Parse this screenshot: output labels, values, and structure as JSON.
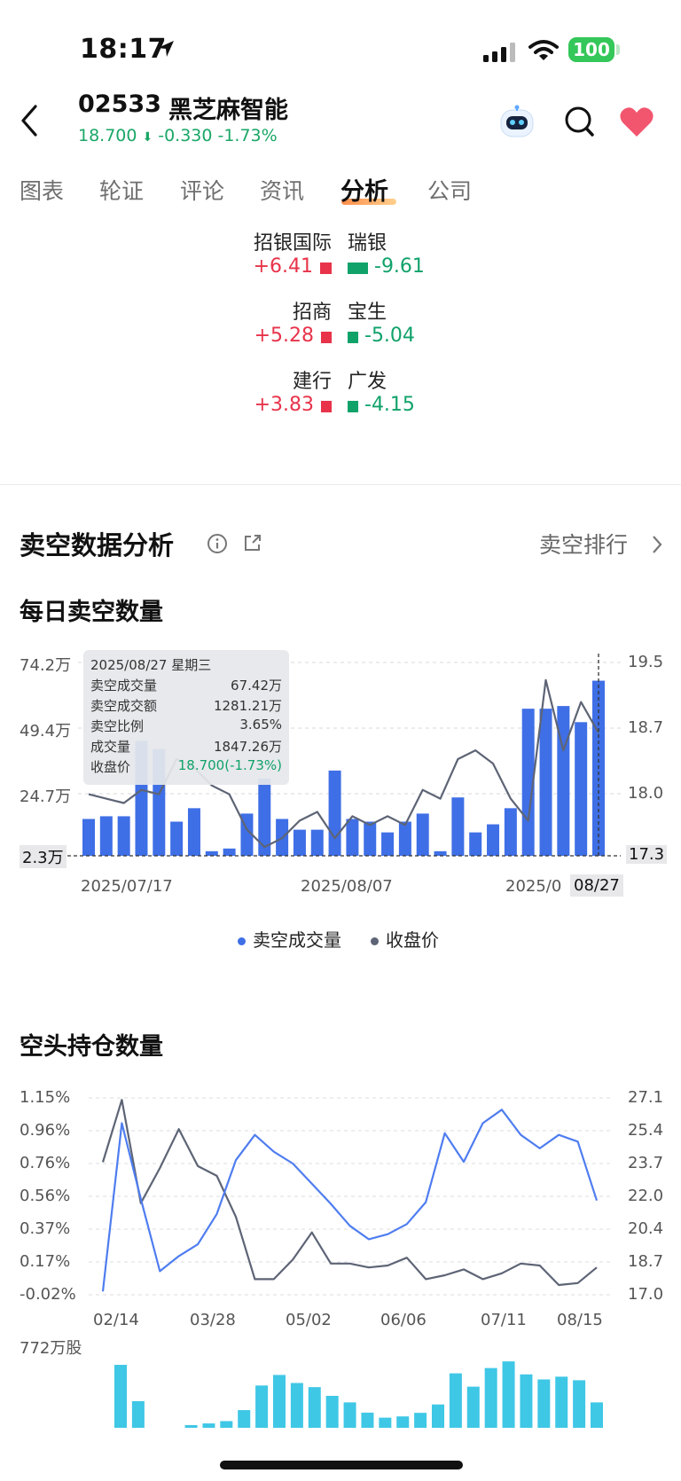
{
  "status_bar": {
    "time": "18:17",
    "battery": "100"
  },
  "header": {
    "code": "02533",
    "name": "黑芝麻智能",
    "price": "18.700",
    "change": "-0.330",
    "change_pct": "-1.73%"
  },
  "tabs": [
    "图表",
    "轮证",
    "评论",
    "资讯",
    "分析",
    "公司"
  ],
  "active_tab": "分析",
  "brokers": [
    {
      "buy_name": "招银国际",
      "buy_value": "+6.41",
      "buy_strength": 0.18,
      "sell_name": "瑞银",
      "sell_value": "-9.61",
      "sell_strength": 0.32
    },
    {
      "buy_name": "招商",
      "buy_value": "+5.28",
      "buy_strength": 0.16,
      "sell_name": "宝生",
      "sell_value": "-5.04",
      "sell_strength": 0.16
    },
    {
      "buy_name": "建行",
      "buy_value": "+3.83",
      "buy_strength": 0.13,
      "sell_name": "广发",
      "sell_value": "-4.15",
      "sell_strength": 0.13
    }
  ],
  "section": {
    "title": "卖空数据分析",
    "link": "卖空排行"
  },
  "colors": {
    "bar_blue": "#3f6fe6",
    "price_line": "#5d6475",
    "rise": "#e8334a",
    "fall": "#11a26a",
    "position_line": "#4f7df0",
    "volume_cyan": "#3fc7e6"
  },
  "chart_data": [
    {
      "type": "bar",
      "title": "每日卖空数量",
      "y_left_ticks": [
        "74.2万",
        "49.4万",
        "24.7万",
        "2.3万"
      ],
      "y_left_range": [
        2.3,
        74.2
      ],
      "y_right_ticks": [
        "19.5",
        "18.7",
        "18.0",
        "17.3"
      ],
      "y_right_range": [
        17.3,
        19.5
      ],
      "x_ticks": [
        "2025/07/17",
        "2025/08/07",
        "2025/0",
        "08/27"
      ],
      "legend": [
        "卖空成交量",
        "收盘价"
      ],
      "series": [
        {
          "name": "卖空成交量",
          "unit": "万",
          "values": [
            16,
            17,
            17,
            45,
            42,
            15,
            20,
            4,
            5,
            18,
            31,
            16,
            12,
            12,
            34,
            16,
            15,
            11,
            15,
            18,
            4,
            24,
            11,
            14,
            20,
            57,
            57,
            58,
            52,
            67.42
          ]
        },
        {
          "name": "收盘价",
          "values": [
            18.0,
            17.95,
            17.9,
            18.05,
            18.0,
            18.4,
            18.3,
            18.1,
            18.0,
            17.6,
            17.4,
            17.5,
            17.7,
            17.8,
            17.5,
            17.75,
            17.65,
            17.75,
            17.65,
            18.05,
            17.95,
            18.4,
            18.5,
            18.35,
            17.95,
            17.7,
            19.3,
            18.5,
            19.05,
            18.7
          ]
        }
      ],
      "tooltip": {
        "date": "2025/08/27 星期三",
        "rows": [
          {
            "label": "卖空成交量",
            "value": "67.42万"
          },
          {
            "label": "卖空成交额",
            "value": "1281.21万"
          },
          {
            "label": "卖空比例",
            "value": "3.65%"
          },
          {
            "label": "成交量",
            "value": "1847.26万"
          },
          {
            "label": "收盘价",
            "value": "18.700(-1.73%)"
          }
        ]
      }
    },
    {
      "type": "line",
      "title": "空头持仓数量",
      "y_left_ticks": [
        "1.15%",
        "0.96%",
        "0.76%",
        "0.56%",
        "0.37%",
        "0.17%",
        "-0.02%"
      ],
      "y_left_range": [
        -0.02,
        1.15
      ],
      "y_right_ticks": [
        "27.1",
        "25.4",
        "23.7",
        "22.0",
        "20.4",
        "18.7",
        "17.0"
      ],
      "y_right_range": [
        17.0,
        27.1
      ],
      "x_ticks": [
        "02/14",
        "03/28",
        "05/02",
        "06/06",
        "07/11",
        "08/15"
      ],
      "volume_label": "772万股",
      "series": [
        {
          "name": "空头持仓比例",
          "values": [
            0.0,
            1.0,
            0.55,
            0.12,
            0.21,
            0.28,
            0.46,
            0.78,
            0.93,
            0.83,
            0.76,
            0.64,
            0.52,
            0.39,
            0.31,
            0.34,
            0.4,
            0.53,
            0.94,
            0.77,
            1.0,
            1.08,
            0.93,
            0.85,
            0.93,
            0.89,
            0.54
          ]
        },
        {
          "name": "收盘价",
          "values": [
            23.8,
            27.0,
            21.7,
            23.5,
            25.5,
            23.6,
            23.1,
            21.0,
            17.8,
            17.8,
            18.8,
            20.2,
            18.6,
            18.6,
            18.4,
            18.5,
            18.9,
            17.8,
            18.0,
            18.3,
            17.8,
            18.1,
            18.6,
            18.5,
            17.5,
            17.6,
            18.4
          ]
        },
        {
          "name": "成交量",
          "unit": "万股",
          "values": [
            548,
            232,
            0,
            0,
            0,
            38,
            58,
            154,
            368,
            460,
            390,
            354,
            278,
            221,
            132,
            88,
            99,
            130,
            203,
            474,
            358,
            520,
            578,
            465,
            421,
            445,
            414,
            221
          ]
        }
      ]
    }
  ]
}
